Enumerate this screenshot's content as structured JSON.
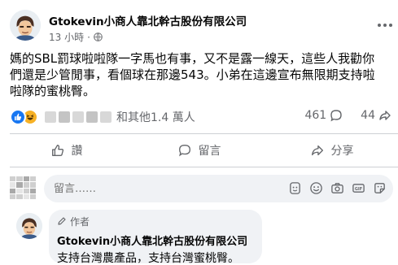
{
  "post": {
    "author": "Gtokevin小商人靠北幹古股份有限公司",
    "time": "13 小時",
    "separator": "·",
    "body": "媽的SBL罰球啦啦隊一字馬也有事，又不是露一線天，這些人我勸你們還是少管閒事，看個球在那邊543。小弟在這邊宣布無限期支持啦啦隊的蜜桃臀。"
  },
  "reactions": {
    "others": "和其他1.4 萬人",
    "comments": "461",
    "shares": "44"
  },
  "actions": {
    "like": "讚",
    "comment": "留言",
    "share": "分享"
  },
  "comment_box": {
    "placeholder": "留言……"
  },
  "reply": {
    "badge": "作者",
    "name": "Gtokevin小商人靠北幹古股份有限公司",
    "text": "支持台灣農產品，支持台灣蜜桃臀。"
  },
  "colors": {
    "accent": "#1877f2",
    "secondary_text": "#65676b",
    "bubble_bg": "#f0f2f5",
    "haha": "#f7b125"
  }
}
